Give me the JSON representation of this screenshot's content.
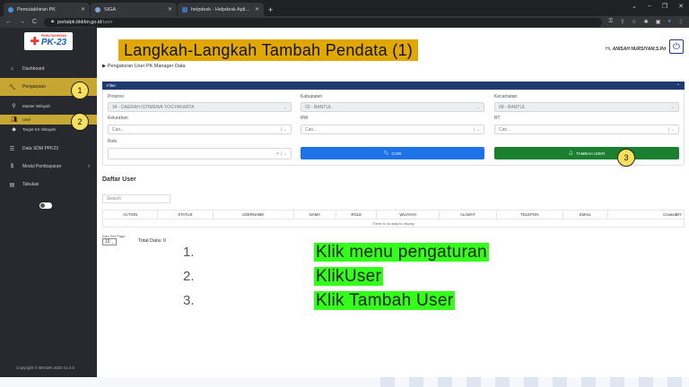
{
  "browser": {
    "tabs": [
      {
        "title": "Pemutakhiran PK"
      },
      {
        "title": "SIGA"
      },
      {
        "title": "helpdesk - Helpdesk Aplikasi, Ja"
      }
    ],
    "url_host": "portalpk.bkkbn.go.id",
    "url_path": "/user"
  },
  "sidebar": {
    "logo_small": "PEMUTAKHIRAN",
    "logo_big": "PK-23",
    "items": [
      {
        "label": "Dashboard",
        "icon": "home-icon"
      },
      {
        "label": "Pengaturan",
        "icon": "wrench-icon"
      },
      {
        "label": "Master Wilayah",
        "icon": "pin-icon"
      },
      {
        "label": "User",
        "icon": "users-icon"
      },
      {
        "label": "Target KK Wilayah",
        "icon": "diamond-icon"
      },
      {
        "label": "Data SDM PPK23",
        "icon": "list-icon"
      },
      {
        "label": "Modul Pembayaran",
        "icon": "dollar-icon"
      },
      {
        "label": "Tabulasi",
        "icon": "table-icon"
      }
    ],
    "copyright": "Copyright © BKKBN 2023 v1.0.0"
  },
  "callouts": [
    "1",
    "2",
    "3"
  ],
  "header": {
    "headline": "Langkah-Langkah Tambah Pendata (1)",
    "greeting": "Hi,",
    "user_name": "ANISAH NURSIYAM,S.Pd",
    "breadcrumb": "▶ Pengaturan User PK Manager Data"
  },
  "filter": {
    "title": "Filter",
    "provinsi_label": "Provinsi",
    "provinsi_value": "34 - DAERAH ISTIMEWA YOGYAKARTA",
    "kabupaten_label": "Kabupaten",
    "kabupaten_value": "02 - BANTUL",
    "kecamatan_label": "Kecamatan",
    "kecamatan_value": "08 - BANTUL",
    "kelurahan_label": "Kelurahan",
    "kelurahan_placeholder": "Cari...",
    "rw_label": "RW",
    "rw_placeholder": "Cari...",
    "rt_label": "RT",
    "rt_placeholder": "Cari...",
    "role_label": "Role",
    "cari_label": "CARI",
    "tambah_label": "TAMBAH USER"
  },
  "daftar": {
    "title": "Daftar User",
    "search_placeholder": "Search",
    "columns": [
      "ACTION",
      "STATUS",
      "USERNAME",
      "NAMA",
      "ROLE",
      "WILAYAH",
      "ALAMAT",
      "TELEPON",
      "EMAIL",
      "CreatedBY"
    ],
    "empty_text": "There is no data to display",
    "size_label": "Size Per Page",
    "size_value": "10",
    "total_label": "Total Data: 0"
  },
  "steps": [
    {
      "num": "1.",
      "text": "Klik menu pengaturan"
    },
    {
      "num": "2.",
      "text": "KlikUser"
    },
    {
      "num": "3.",
      "text": "Klik Tambah User"
    }
  ]
}
